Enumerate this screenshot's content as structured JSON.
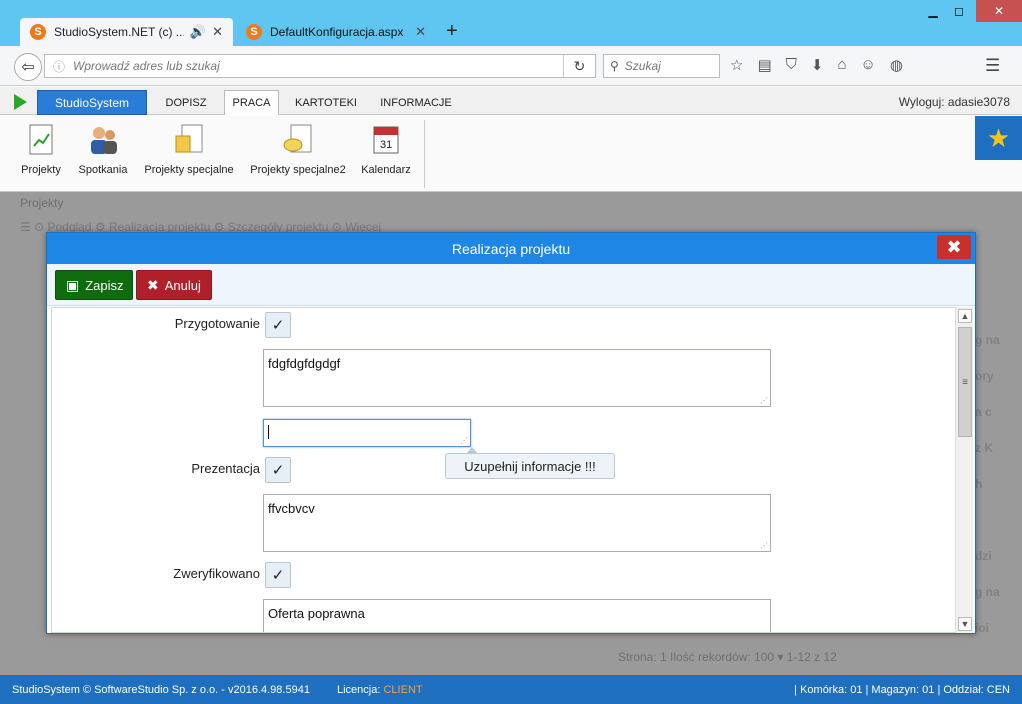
{
  "browser": {
    "tabs": [
      {
        "label": "StudioSystem.NET (c) ...",
        "active": true
      },
      {
        "label": "DefaultKonfiguracja.aspx",
        "active": false
      }
    ],
    "url_placeholder": "Wprowadź adres lub szukaj",
    "search_placeholder": "Szukaj"
  },
  "app": {
    "brand": "StudioSystem",
    "tabs": [
      "DOPISZ",
      "PRACA",
      "KARTOTEKI",
      "INFORMACJE"
    ],
    "active_tab": "PRACA",
    "logout": "Wyloguj: adasie3078",
    "ribbon": [
      "Projekty",
      "Spotkania",
      "Projekty specjalne",
      "Projekty specjalne2",
      "Kalendarz"
    ]
  },
  "background": {
    "breadcrumb": "Projekty",
    "tools": "☰   ⊙ Podgląd    ⚙ Realizacja projektu    ⚙ Szczegóły projektu    ⊙ Więcej",
    "pager": "Strona:   1   Ilość rekordów:   100 ▾   1-12 z 12",
    "right_fragments": [
      "g na",
      "ory",
      "a c",
      "z K",
      "h",
      "dzi",
      "g na",
      "ioi"
    ]
  },
  "dialog": {
    "title": "Realizacja projektu",
    "save_label": "Zapisz",
    "cancel_label": "Anuluj",
    "fields": [
      {
        "label": "Przygotowanie",
        "checked": "✓",
        "text": "fdgfdgfdgdgf",
        "note": ""
      },
      {
        "label": "Prezentacja",
        "checked": "✓",
        "text": "ffvcbvcv"
      },
      {
        "label": "Zweryfikowano",
        "checked": "✓",
        "text": "Oferta poprawna"
      }
    ],
    "tooltip": "Uzupełnij informacje !!!"
  },
  "status": {
    "left": "StudioSystem © SoftwareStudio Sp. z o.o. - v2016.4.98.5941",
    "license_label": "Licencja: ",
    "license_value": "CLIENT",
    "right": "| Komórka: 01 | Magazyn: 01 | Oddział: CEN"
  }
}
